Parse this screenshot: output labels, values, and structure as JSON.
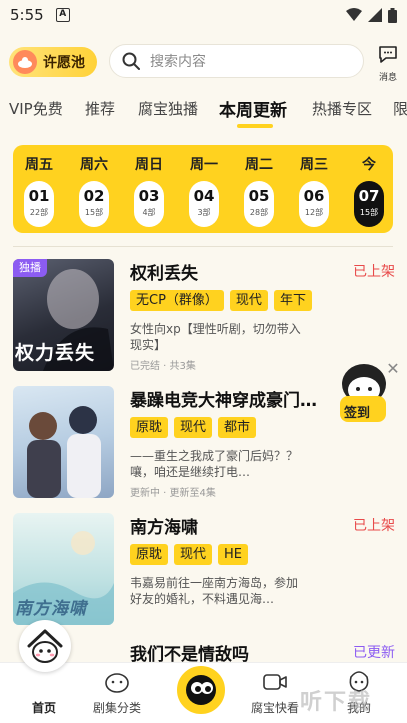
{
  "status_bar": {
    "time": "5:55",
    "notification_letter": "A"
  },
  "top_bar": {
    "wish_label": "许愿池",
    "search_placeholder": "搜索内容",
    "message_label": "消息"
  },
  "tabs": [
    {
      "label": "VIP免费"
    },
    {
      "label": "推荐"
    },
    {
      "label": "腐宝独播"
    },
    {
      "label": "本周更新",
      "active": true
    },
    {
      "label": "热播专区"
    },
    {
      "label": "限"
    }
  ],
  "week": [
    {
      "day": "周五",
      "date": "01",
      "count": "22部"
    },
    {
      "day": "周六",
      "date": "02",
      "count": "15部"
    },
    {
      "day": "周日",
      "date": "03",
      "count": "4部"
    },
    {
      "day": "周一",
      "date": "04",
      "count": "3部"
    },
    {
      "day": "周二",
      "date": "05",
      "count": "28部"
    },
    {
      "day": "周三",
      "date": "06",
      "count": "12部"
    },
    {
      "day": "今",
      "date": "07",
      "count": "15部",
      "selected": true
    }
  ],
  "items": [
    {
      "badge": "独播",
      "cover_text": "权力丢失",
      "title": "权利丢失",
      "status": "已上架",
      "tags": [
        "无CP（群像）",
        "现代",
        "年下"
      ],
      "desc": "女性向xp【理性听剧，切勿带入现实】",
      "meta": "已完结 · 共3集"
    },
    {
      "badge": "",
      "cover_text": "",
      "title": "暴躁电竞大神穿成豪门…",
      "status": "",
      "tags": [
        "原耽",
        "现代",
        "都市"
      ],
      "desc": "——重生之我成了豪门后妈？？嚷，咱还是继续打电…",
      "meta": "更新中 · 更新至4集"
    },
    {
      "badge": "",
      "cover_text": "南方海啸",
      "title": "南方海啸",
      "status": "已上架",
      "tags": [
        "原耽",
        "现代",
        "HE"
      ],
      "desc": "韦嘉易前往一座南方海岛，参加好友的婚礼，不料遇见海…",
      "meta": ""
    },
    {
      "badge": "",
      "cover_text": "",
      "title": "我们不是情敌吗",
      "status": "已更新",
      "tags": [],
      "desc": "",
      "meta": ""
    }
  ],
  "float_sign_label": "签到",
  "bottom_nav": [
    {
      "label": "首页"
    },
    {
      "label": "剧集分类"
    },
    {
      "label": ""
    },
    {
      "label": "腐宝快看"
    },
    {
      "label": "我的"
    }
  ],
  "watermark": "听下载",
  "colors": {
    "accent": "#ffd21f",
    "status_red": "#e84a4a",
    "badge_purple": "#8c5cf2"
  }
}
